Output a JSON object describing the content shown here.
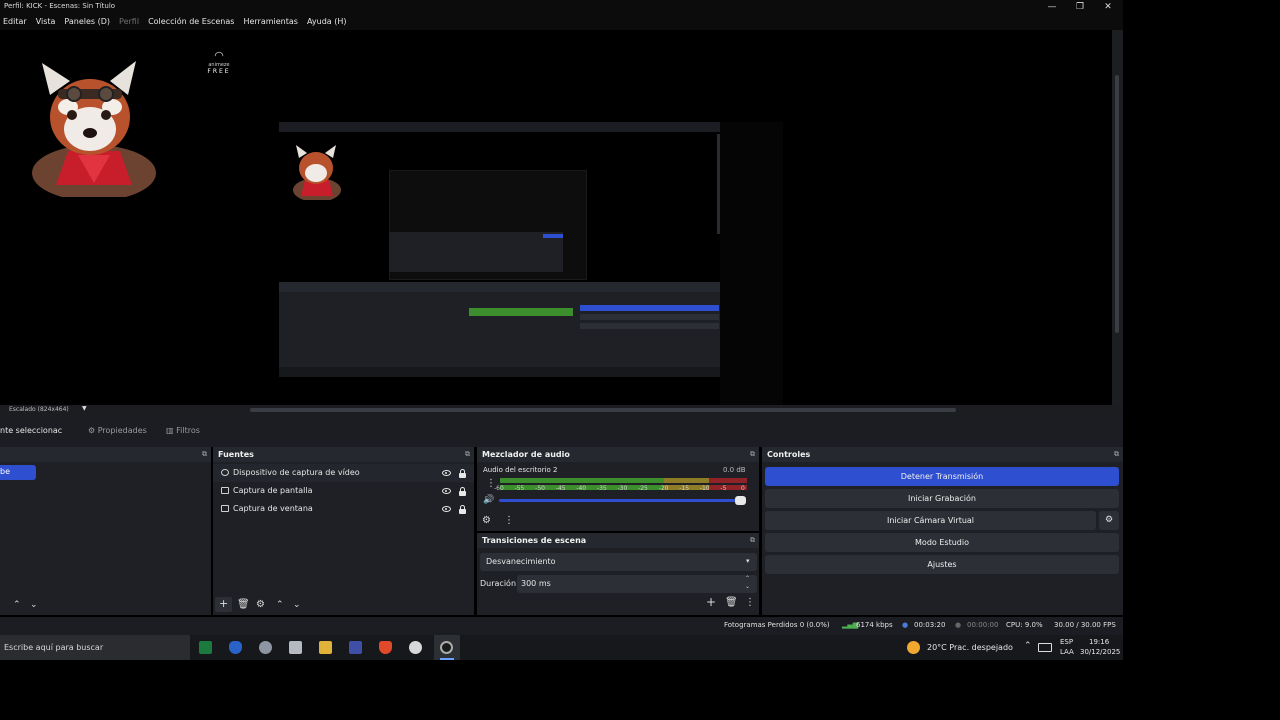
{
  "window": {
    "title": "Perfil: KICK - Escenas: Sin Título",
    "controls": {
      "minimize": "—",
      "maximize": "❐",
      "close": "✕"
    }
  },
  "menu": [
    "Editar",
    "Vista",
    "Paneles (D)",
    "Perfil",
    "Colección de Escenas",
    "Herramientas",
    "Ayuda (H)"
  ],
  "preview": {
    "watermark_brand": "animeze",
    "watermark_free": "FREE",
    "scale_label": "Escalado (824x464)"
  },
  "context_bar": {
    "no_source": "nte seleccionac",
    "properties": "Propiedades",
    "filters": "Filtros"
  },
  "scenes": {
    "selected_fragment": "be"
  },
  "sources": {
    "title": "Fuentes",
    "items": [
      {
        "label": "Dispositivo de captura de vídeo",
        "icon": "camera-icon"
      },
      {
        "label": "Captura de pantalla",
        "icon": "monitor-icon"
      },
      {
        "label": "Captura de ventana",
        "icon": "window-icon"
      }
    ]
  },
  "audio_mixer": {
    "title": "Mezclador de audio",
    "track_name": "Audio del escritorio 2",
    "db": "0.0 dB",
    "scale": [
      "-60",
      "-55",
      "-50",
      "-45",
      "-40",
      "-35",
      "-30",
      "-25",
      "-20",
      "-15",
      "-10",
      "-5",
      "0"
    ],
    "volume_level": 1.0
  },
  "transitions": {
    "title": "Transiciones de escena",
    "selected": "Desvanecimiento",
    "duration_label": "Duración",
    "duration_value": "300 ms"
  },
  "controls": {
    "title": "Controles",
    "stop_stream": "Detener Transmisión",
    "start_recording": "Iniciar Grabación",
    "start_virtual_cam": "Iniciar Cámara Virtual",
    "studio_mode": "Modo Estudio",
    "settings": "Ajustes"
  },
  "status": {
    "dropped": "Fotogramas Perdidos 0 (0.0%)",
    "bitrate": "6174 kbps",
    "stream_time": "00:03:20",
    "rec_time": "00:00:00",
    "cpu": "CPU: 9.0%",
    "fps": "30.00 / 30.00 FPS"
  },
  "taskbar": {
    "search_placeholder": "Escribe aquí para buscar",
    "weather": "20°C  Prac. despejado",
    "lang_top": "ESP",
    "lang_bottom": "LAA",
    "time": "19:16",
    "date": "30/12/2025"
  },
  "colors": {
    "accent": "#2f4fd1",
    "meter_green": "#3c8f2c",
    "meter_yellow": "#8f7c27",
    "meter_red": "#8f2327"
  }
}
